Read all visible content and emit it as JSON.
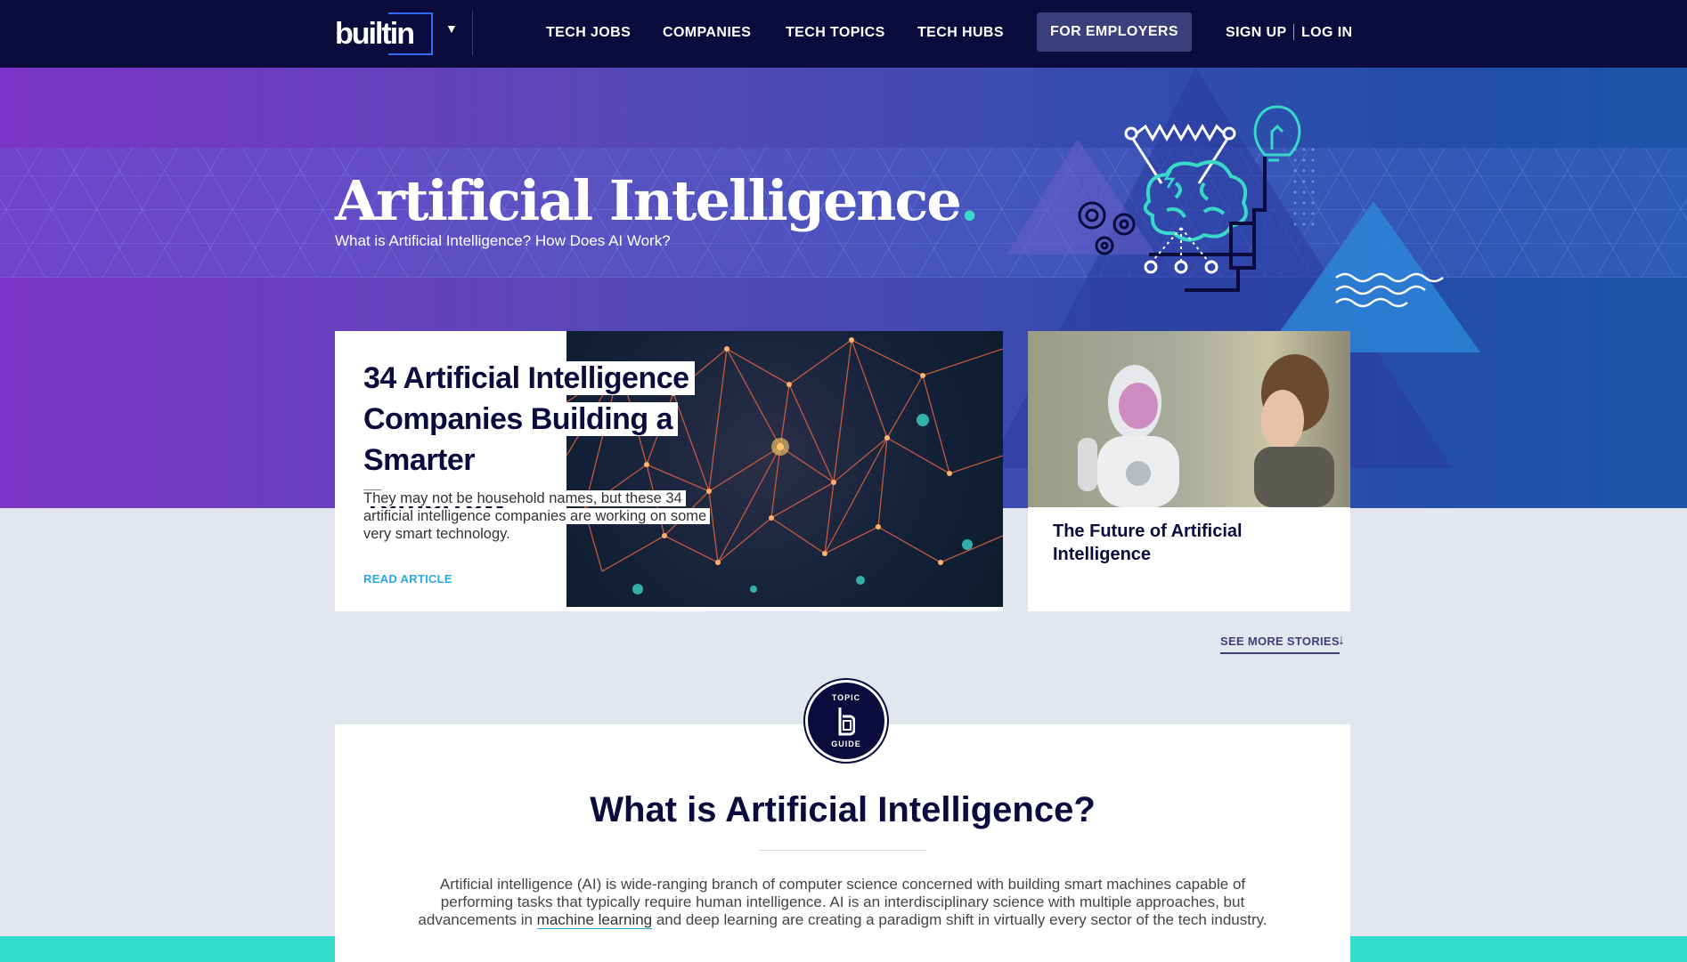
{
  "nav": {
    "logo": "builtin",
    "links": [
      "TECH JOBS",
      "COMPANIES",
      "TECH TOPICS",
      "TECH HUBS"
    ],
    "employers": "FOR EMPLOYERS",
    "signup": "SIGN UP",
    "login": "LOG IN"
  },
  "hero": {
    "title": "Artificial Intelligence",
    "title_dot": ".",
    "subtitle": "What is Artificial Intelligence? How Does AI Work?"
  },
  "featured": {
    "title_lines": [
      "34 Artificial Intelligence",
      "Companies Building a Smarter",
      "Tomorrow"
    ],
    "description": "They may not be household names, but these 34 artificial intelligence companies are working on some very smart technology.",
    "cta": "READ ARTICLE"
  },
  "side_story": {
    "title": "The Future of Artificial Intelligence"
  },
  "see_more": {
    "label": "SEE MORE STORIES",
    "arrow": "↓"
  },
  "guide": {
    "badge_top": "TOPIC",
    "badge_bottom": "GUIDE",
    "title": "What is Artificial Intelligence?",
    "body_before": "Artificial intelligence (AI) is wide-ranging branch of computer science concerned with building smart machines capable of performing tasks that typically require human intelligence. AI is an interdisciplinary science with multiple approaches, but advancements in ",
    "body_link": "machine learning",
    "body_after": " and deep learning are creating a paradigm shift in virtually every sector of the tech industry."
  },
  "colors": {
    "navy": "#0b0b3d",
    "teal": "#37d9c9",
    "link_blue": "#2ba9e0",
    "employers_bg": "#3b3f7c"
  }
}
